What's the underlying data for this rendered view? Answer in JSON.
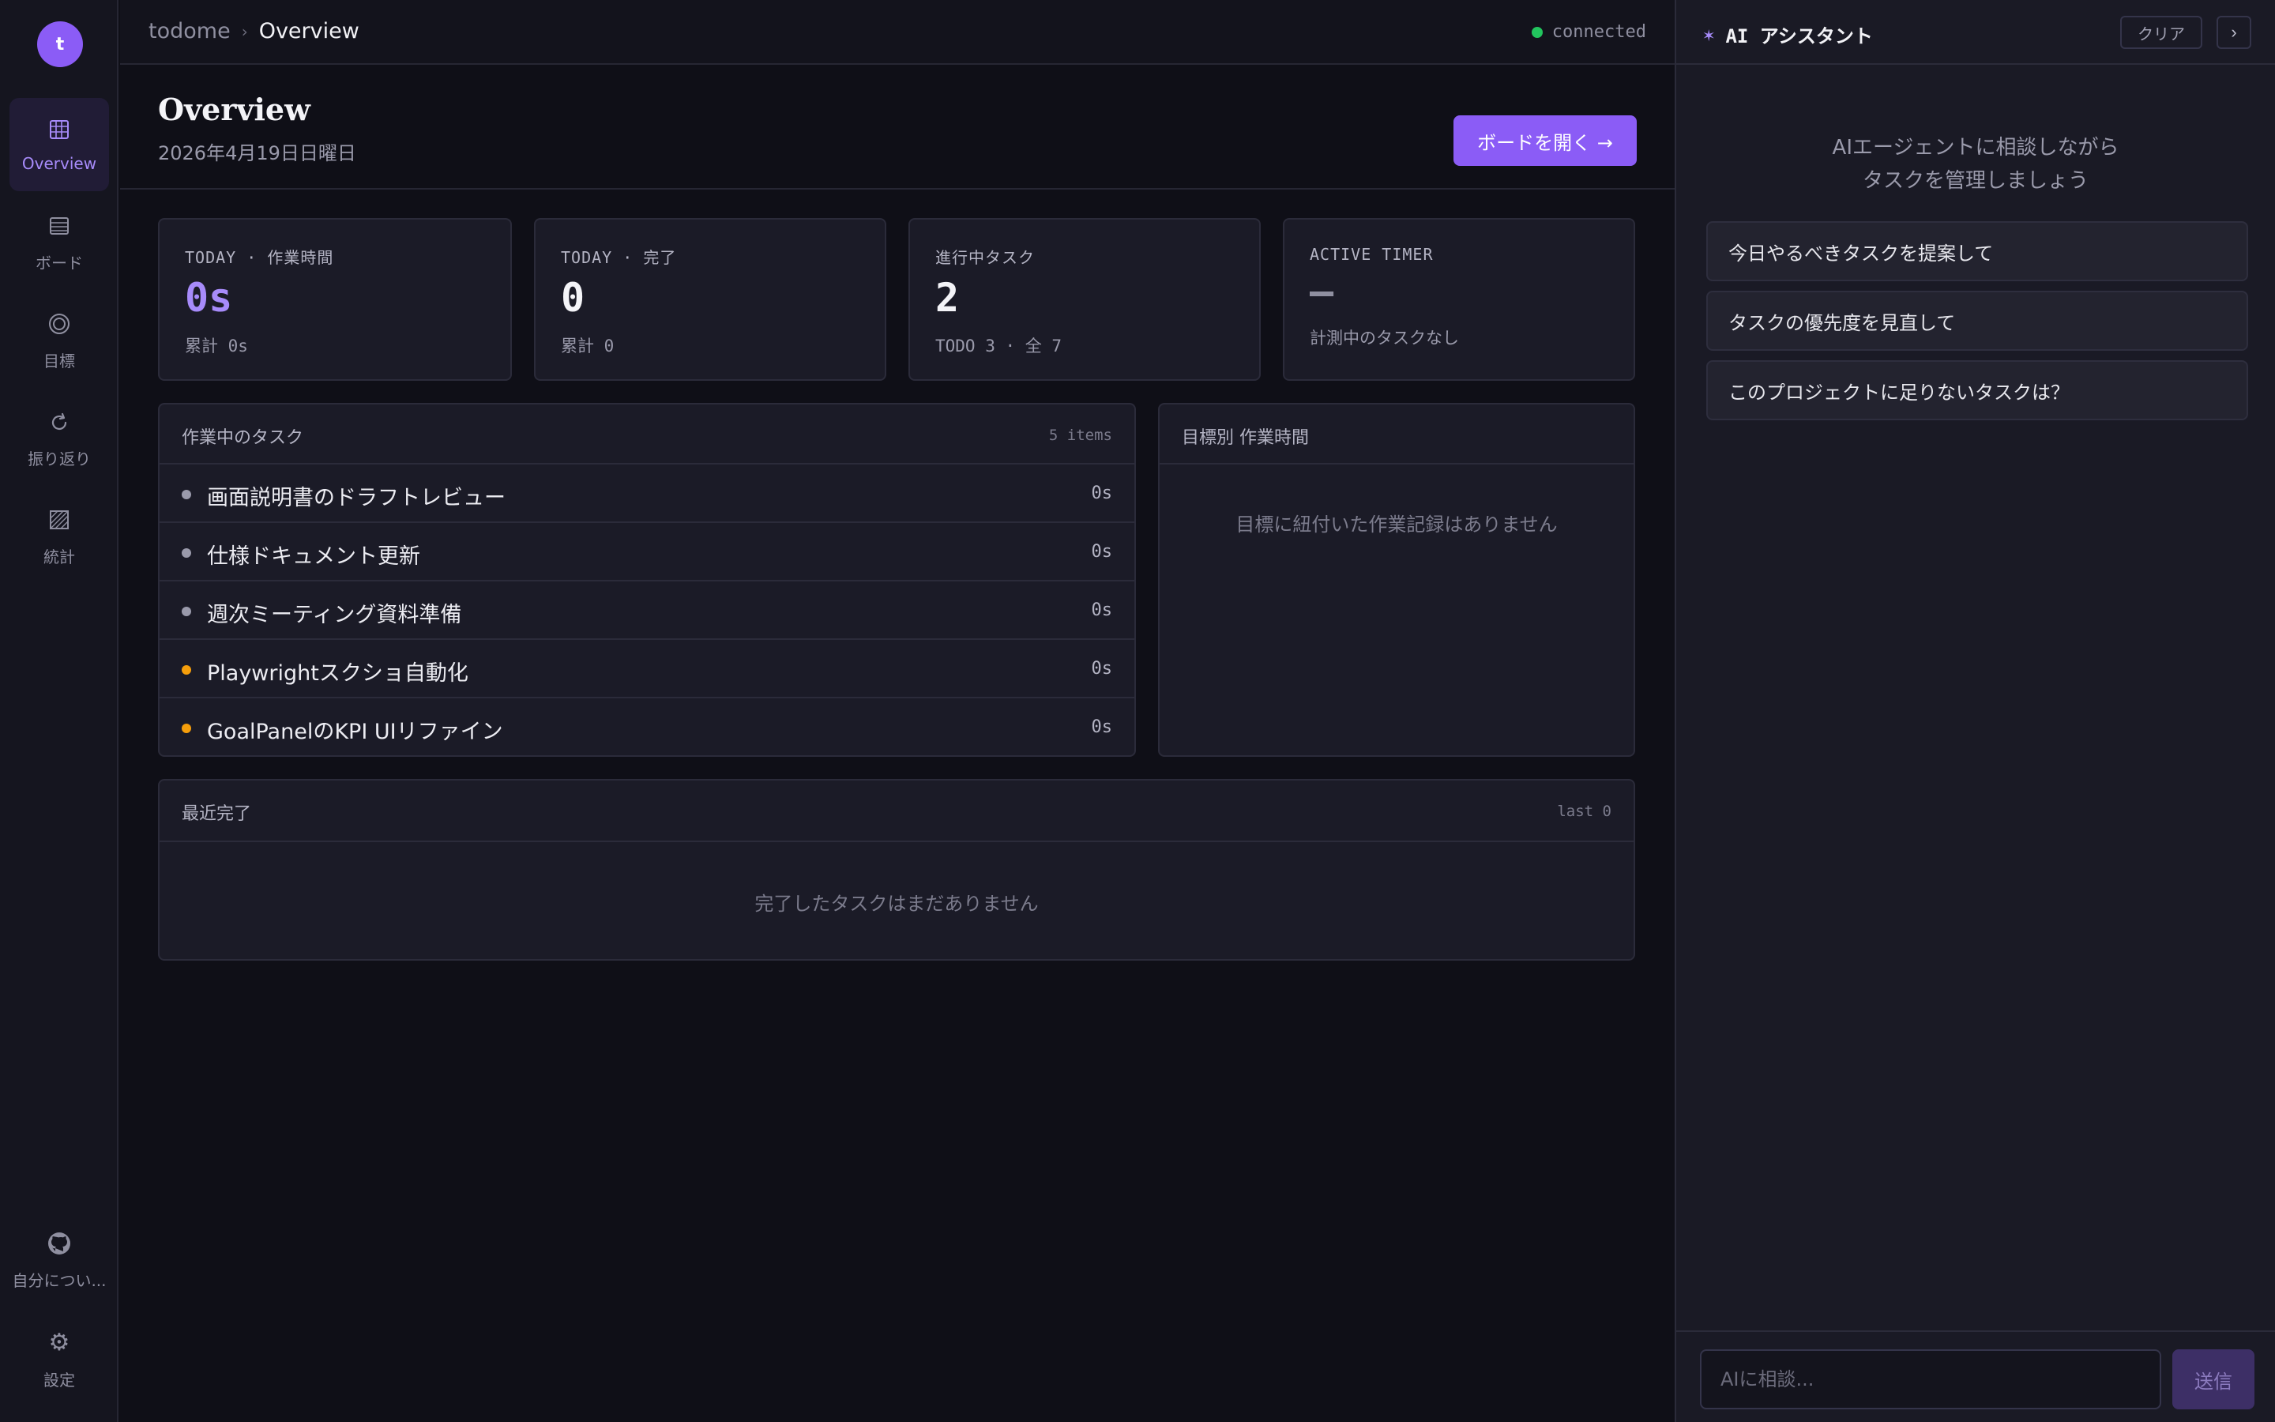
{
  "sidebar": {
    "avatar_letter": "t",
    "items": [
      {
        "label": "Overview",
        "icon": "grid-icon"
      },
      {
        "label": "ボード",
        "icon": "board-icon"
      },
      {
        "label": "目標",
        "icon": "target-icon"
      },
      {
        "label": "振り返り",
        "icon": "refresh-icon"
      },
      {
        "label": "統計",
        "icon": "chart-icon"
      }
    ],
    "bottom": [
      {
        "label": "自分につい...",
        "icon": "github-icon"
      },
      {
        "label": "設定",
        "icon": "gear-icon"
      }
    ]
  },
  "topbar": {
    "breadcrumb_root": "todome",
    "breadcrumb_sep": "›",
    "breadcrumb_current": "Overview",
    "status": "connected",
    "status_color": "#22c55e"
  },
  "header": {
    "title": "Overview",
    "date": "2026年4月19日日曜日",
    "open_board_label": "ボードを開く →"
  },
  "stats": [
    {
      "label": "TODAY · 作業時間",
      "value": "0s",
      "sub": "累計 0s"
    },
    {
      "label": "TODAY · 完了",
      "value": "0",
      "sub": "累計 0"
    },
    {
      "label": "進行中タスク",
      "value": "2",
      "sub": "TODO 3 · 全 7"
    },
    {
      "label": "ACTIVE TIMER",
      "value": "—",
      "sub": "計測中のタスクなし"
    }
  ],
  "active_tasks": {
    "title": "作業中のタスク",
    "count": "5 items",
    "items": [
      {
        "name": "画面説明書のドラフトレビュー",
        "time": "0s",
        "dot": "#9a9aab"
      },
      {
        "name": "仕様ドキュメント更新",
        "time": "0s",
        "dot": "#9a9aab"
      },
      {
        "name": "週次ミーティング資料準備",
        "time": "0s",
        "dot": "#9a9aab"
      },
      {
        "name": "Playwrightスクショ自動化",
        "time": "0s",
        "dot": "#f59e0b"
      },
      {
        "name": "GoalPanelのKPI UIリファイン",
        "time": "0s",
        "dot": "#f59e0b"
      }
    ]
  },
  "goal_time": {
    "title": "目標別 作業時間",
    "empty": "目標に紐付いた作業記録はありません"
  },
  "recent": {
    "title": "最近完了",
    "meta": "last 0",
    "empty": "完了したタスクはまだありません"
  },
  "ai": {
    "title": "AI アシスタント",
    "star": "✶",
    "clear_label": "クリア",
    "collapse_label": "›",
    "intro_line1": "AIエージェントに相談しながら",
    "intro_line2": "タスクを管理しましょう",
    "suggestions": [
      "今日やるべきタスクを提案して",
      "タスクの優先度を見直して",
      "このプロジェクトに足りないタスクは？"
    ],
    "input_placeholder": "AIに相談...",
    "send_label": "送信"
  },
  "colors": {
    "accent": "#8b5cf6",
    "accent_light": "#a78bfa",
    "background": "#0f0f17"
  }
}
